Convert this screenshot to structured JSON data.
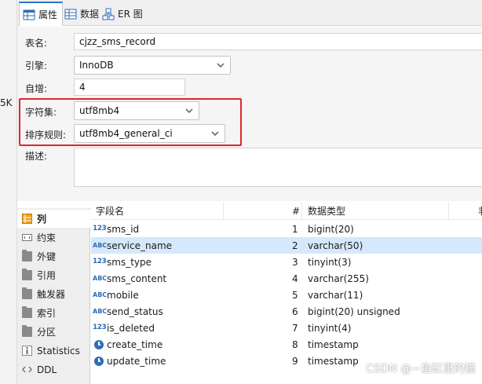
{
  "tabs": [
    {
      "label": "属性",
      "icon": "table-grid-icon",
      "active": true
    },
    {
      "label": "数据",
      "icon": "data-grid-icon",
      "active": false
    },
    {
      "label": "ER 图",
      "icon": "er-diagram-icon",
      "active": false
    }
  ],
  "left_strip": {
    "size_label": "5K"
  },
  "form": {
    "table_name": {
      "label": "表名:",
      "value": "cjzz_sms_record"
    },
    "engine": {
      "label": "引擎:",
      "value": "InnoDB"
    },
    "auto_increment": {
      "label": "自增:",
      "value": "4"
    },
    "charset": {
      "label": "字符集:",
      "value": "utf8mb4"
    },
    "collation": {
      "label": "排序规则:",
      "value": "utf8mb4_general_ci"
    },
    "description": {
      "label": "描述:",
      "value": ""
    }
  },
  "nav": [
    {
      "label": "列",
      "icon": "columns-icon",
      "active": true
    },
    {
      "label": "约束",
      "icon": "constraint-icon",
      "active": false
    },
    {
      "label": "外键",
      "icon": "folder-icon",
      "active": false
    },
    {
      "label": "引用",
      "icon": "folder-icon",
      "active": false
    },
    {
      "label": "触发器",
      "icon": "folder-icon",
      "active": false
    },
    {
      "label": "索引",
      "icon": "folder-icon",
      "active": false
    },
    {
      "label": "分区",
      "icon": "folder-icon",
      "active": false
    },
    {
      "label": "Statistics",
      "icon": "info-icon",
      "active": false
    },
    {
      "label": "DDL",
      "icon": "ddl-icon",
      "active": false
    }
  ],
  "grid": {
    "headers": {
      "name": "字段名",
      "num": "#",
      "type": "数据类型",
      "extra": "非"
    },
    "rows": [
      {
        "type_icon": "123",
        "name": "sms_id",
        "num": "1",
        "datatype": "bigint(20)",
        "selected": false
      },
      {
        "type_icon": "ABC",
        "name": "service_name",
        "num": "2",
        "datatype": "varchar(50)",
        "selected": true
      },
      {
        "type_icon": "123",
        "name": "sms_type",
        "num": "3",
        "datatype": "tinyint(3)",
        "selected": false
      },
      {
        "type_icon": "ABC",
        "name": "sms_content",
        "num": "4",
        "datatype": "varchar(255)",
        "selected": false
      },
      {
        "type_icon": "ABC",
        "name": "mobile",
        "num": "5",
        "datatype": "varchar(11)",
        "selected": false
      },
      {
        "type_icon": "ABC",
        "name": "send_status",
        "num": "6",
        "datatype": "bigint(20) unsigned",
        "selected": false
      },
      {
        "type_icon": "123",
        "name": "is_deleted",
        "num": "7",
        "datatype": "tinyint(4)",
        "selected": false
      },
      {
        "type_icon": "clock",
        "name": "create_time",
        "num": "8",
        "datatype": "timestamp",
        "selected": false
      },
      {
        "type_icon": "clock",
        "name": "update_time",
        "num": "9",
        "datatype": "timestamp",
        "selected": false
      }
    ]
  },
  "watermark": "CSDN @~鱼缸里的猫",
  "colors": {
    "accent": "#2a74c9",
    "highlight": "#e0262b",
    "selected_row": "#d6e8fb",
    "type_icon": "#2f6db6"
  }
}
